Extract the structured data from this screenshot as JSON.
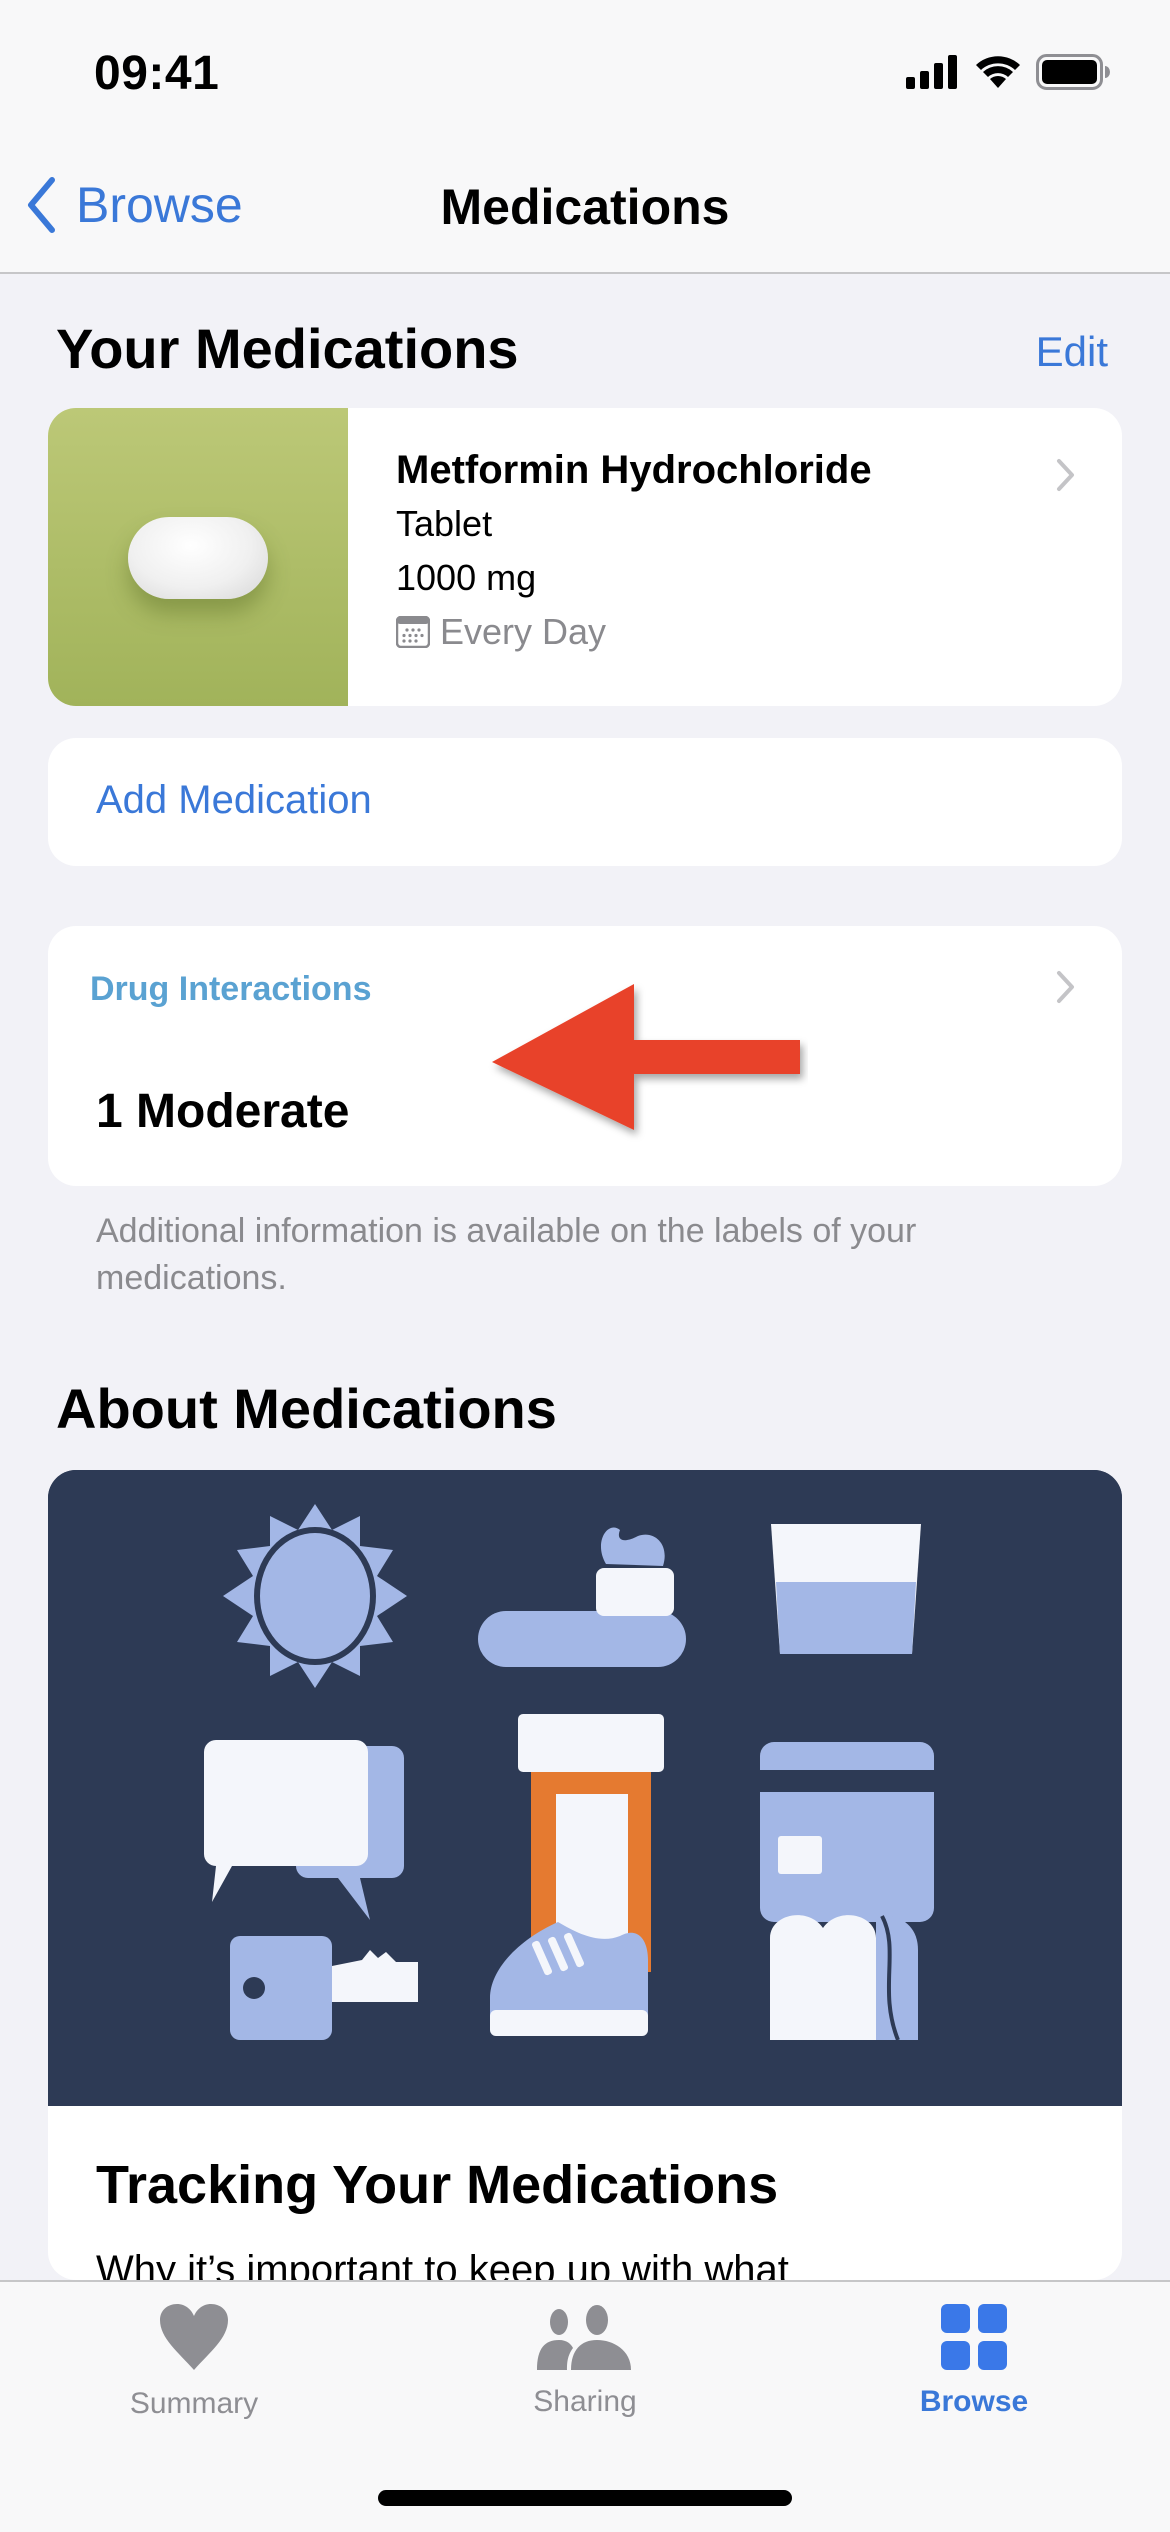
{
  "status_bar": {
    "time": "09:41",
    "icons": [
      "signal-icon",
      "wifi-icon",
      "battery-icon"
    ]
  },
  "nav": {
    "back_label": "Browse",
    "title": "Medications"
  },
  "your_medications": {
    "header": "Your Medications",
    "edit_label": "Edit",
    "medication": {
      "name": "Metformin Hydrochloride",
      "form": "Tablet",
      "dose": "1000 mg",
      "frequency": "Every Day",
      "image_color": "#b0c168"
    },
    "add_label": "Add Medication"
  },
  "drug_interactions": {
    "title": "Drug Interactions",
    "value": "1 Moderate",
    "footnote": "Additional information is available on the labels of your medications."
  },
  "about": {
    "header": "About Medications",
    "illustration_items": [
      "sun-icon",
      "toothbrush-icon",
      "water-glass-icon",
      "speech-bubbles-icon",
      "pill-bottle-icon",
      "credit-card-icon",
      "key-icon",
      "sneaker-icon",
      "bread-icon"
    ],
    "article_title": "Tracking Your Medications",
    "article_subtitle": "Why it’s important to keep up with what"
  },
  "tab_bar": {
    "tabs": [
      {
        "label": "Summary",
        "icon": "heart-icon",
        "active": false
      },
      {
        "label": "Sharing",
        "icon": "people-icon",
        "active": false
      },
      {
        "label": "Browse",
        "icon": "grid-icon",
        "active": true
      }
    ]
  },
  "colors": {
    "accent": "#3a78d8",
    "annotation_arrow": "#e8432a",
    "secondary_text": "#8a8a8e",
    "illustration_bg": "#2d3a55"
  }
}
